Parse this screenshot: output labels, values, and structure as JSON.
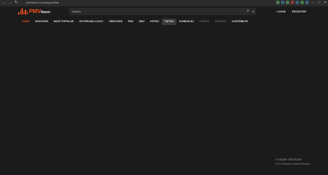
{
  "browser": {
    "url": "pmvhaven.com/category/tiktok"
  },
  "header": {
    "logo_main": "PMV",
    "logo_sub": "Haven",
    "search_placeholder": "Search",
    "login": "LOGIN",
    "register": "REGISTER"
  },
  "nav": {
    "items": [
      {
        "label": "HOME",
        "state": "active"
      },
      {
        "label": "DISCOVER",
        "state": "normal"
      },
      {
        "label": "MOST POPULAR",
        "state": "normal"
      },
      {
        "label": "I'M FEELING LUCKY",
        "state": "normal"
      },
      {
        "label": "CREATORS",
        "state": "normal"
      },
      {
        "label": "PMV",
        "state": "normal"
      },
      {
        "label": "HMV",
        "state": "normal"
      },
      {
        "label": "HYPNO",
        "state": "normal"
      },
      {
        "label": "TIKTOK",
        "state": "selected"
      },
      {
        "label": "KOREAN BJ",
        "state": "normal"
      },
      {
        "label": "EVENTS",
        "state": "dim"
      },
      {
        "label": "ARCHIVE",
        "state": "dim"
      },
      {
        "label": "CONTRIBUTE",
        "state": "normal"
      }
    ]
  },
  "watermark": {
    "line1": "Activate Windows",
    "line2": "Go to Settings to activate Windows."
  },
  "colors": {
    "accent": "#e8501e",
    "background": "#1b1b1b",
    "search_bg": "#2a2a2a"
  }
}
